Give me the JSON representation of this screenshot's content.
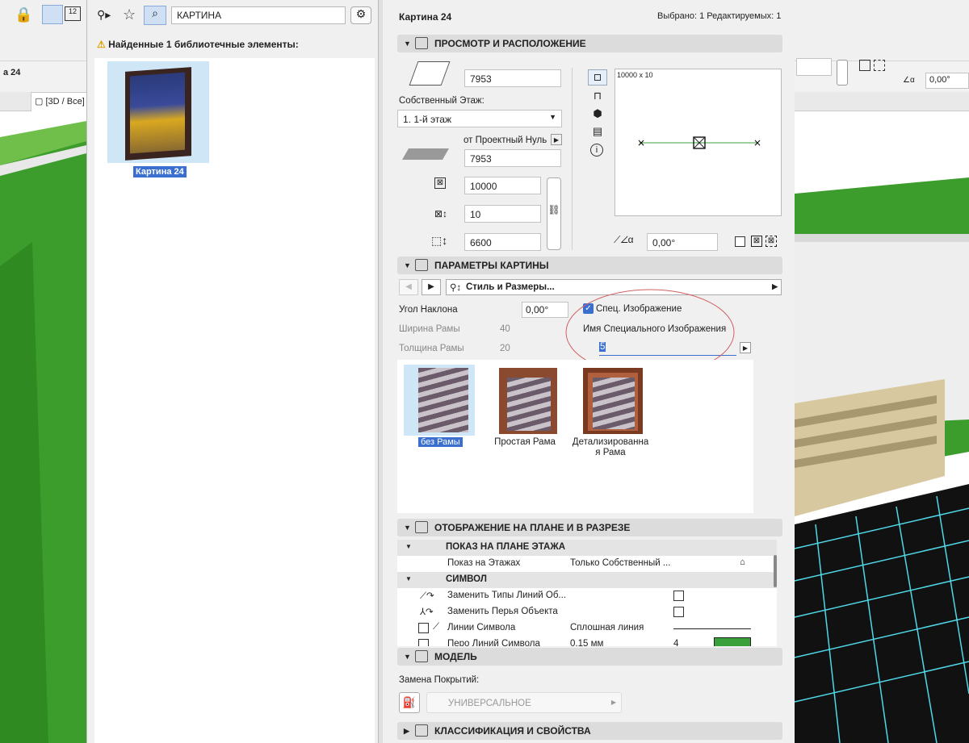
{
  "library": {
    "search_value": "КАРТИНА",
    "found_text": "Найденные 1 библиотечные элементы:",
    "item_label": "Картина 24"
  },
  "viewport": {
    "tab_label": "[3D / Все]",
    "level_label": "а 24",
    "angle_value": "0,00°"
  },
  "header": {
    "title": "Картина 24",
    "selection": "Выбрано: 1 Редактируемых: 1"
  },
  "sections": {
    "view": "ПРОСМОТР И РАСПОЛОЖЕНИЕ",
    "params": "ПАРАМЕТРЫ КАРТИНЫ",
    "plan": "ОТОБРАЖЕНИЕ НА ПЛАНЕ И В РАЗРЕЗЕ",
    "model": "МОДЕЛЬ",
    "classification": "КЛАССИФИКАЦИЯ И СВОЙСТВА"
  },
  "view": {
    "elevation_top": "7953",
    "home_story_label": "Собственный Этаж:",
    "home_story_value": "1. 1-й этаж",
    "reference_label": "от Проектный Нуль",
    "elevation_ref": "7953",
    "width": "10000",
    "depth": "10",
    "height": "6600",
    "preview_size": "10000 x 10",
    "rotation": "0,00°"
  },
  "params": {
    "page_label": "Стиль и Размеры...",
    "tilt_label": "Угол Наклона",
    "tilt_value": "0,00°",
    "frame_width_label": "Ширина Рамы",
    "frame_width_value": "40",
    "frame_thickness_label": "Толщина Рамы",
    "frame_thickness_value": "20",
    "custom_image_label": "Спец. Изображение",
    "custom_image_name_label": "Имя Специального Изображения",
    "custom_image_name_value": "5",
    "frames": [
      {
        "label": "без Рамы"
      },
      {
        "label": "Простая Рама"
      },
      {
        "label_line1": "Детализированна",
        "label_line2": "я Рама"
      }
    ]
  },
  "plan": {
    "group1": "ПОКАЗ НА ПЛАНЕ ЭТАЖА",
    "show_on_stories_label": "Показ на Этажах",
    "show_on_stories_value": "Только Собственный ...",
    "group2": "СИМВОЛ",
    "override_line_types": "Заменить Типы Линий Об...",
    "override_pens": "Заменить Перья Объекта",
    "symbol_lines_label": "Линии Символа",
    "symbol_lines_value": "Сплошная линия",
    "symbol_pens_label": "Перо Линий Символа",
    "symbol_pens_value": "0,15 мм",
    "symbol_pens_num": "4"
  },
  "model": {
    "surface_override_label": "Замена Покрытий:",
    "surface_value": "УНИВЕРСАЛЬНОЕ"
  },
  "colors": {
    "accent": "#3a6fcf",
    "green_wall": "#3c9c2c",
    "floor_grid": "#4fd8e8",
    "annotation_red": "#d06060"
  }
}
